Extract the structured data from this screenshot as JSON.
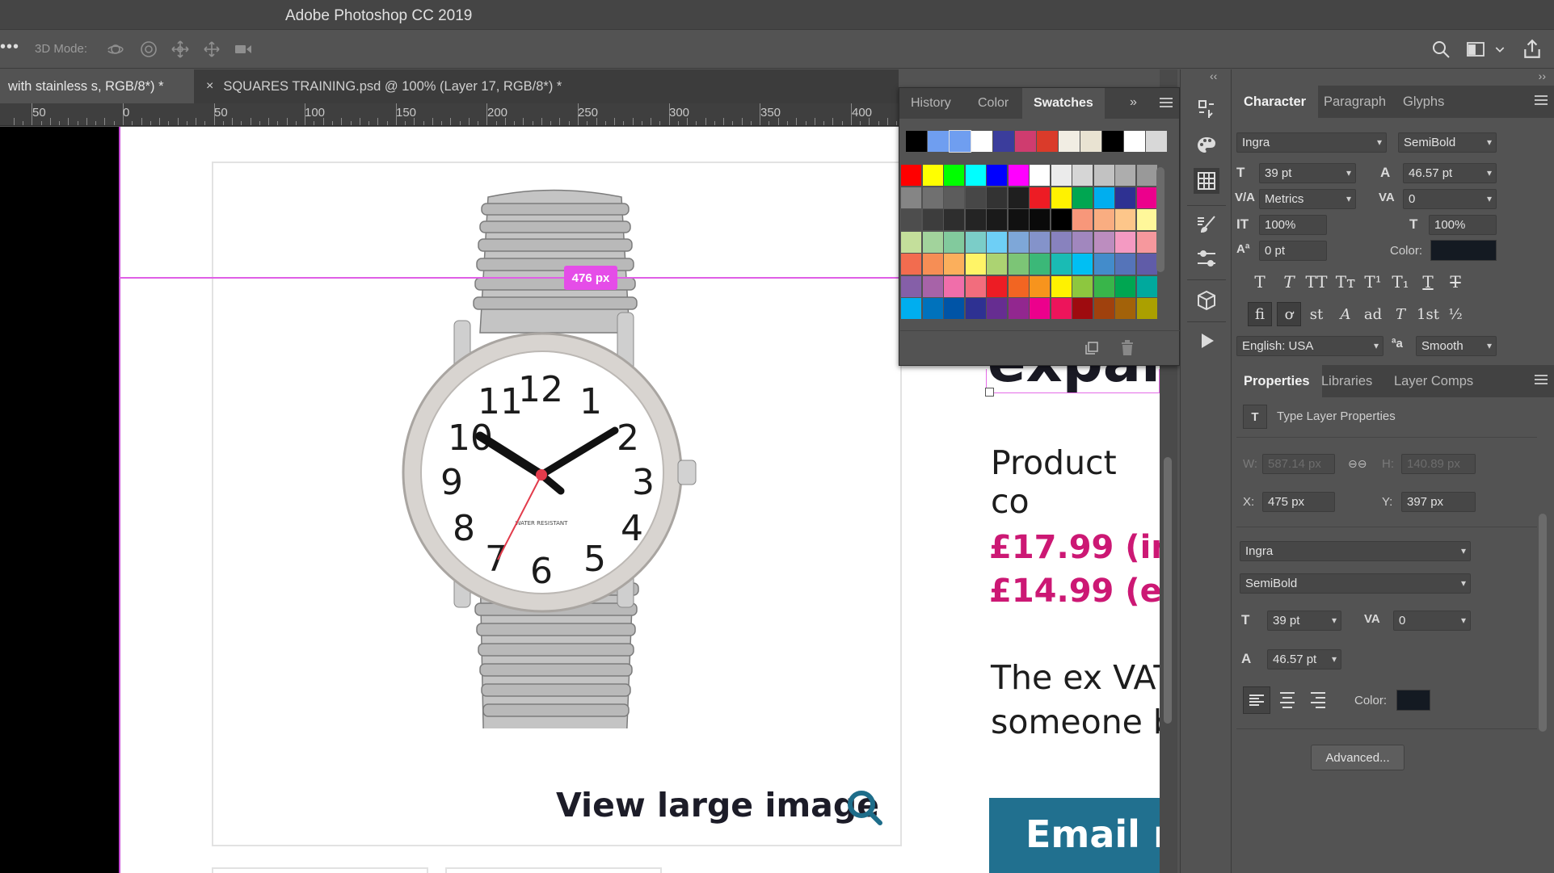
{
  "app": {
    "title": "Adobe Photoshop CC 2019"
  },
  "options_bar": {
    "more_label": "•••",
    "mode_label": "3D Mode:",
    "icons": [
      "orbit-3d-icon",
      "roll-3d-icon",
      "drag-3d-icon",
      "slide-3d-icon",
      "scale-3d-video-icon"
    ],
    "right_icons": [
      "search-icon",
      "workspace-icon",
      "chevron-down-icon",
      "share-icon"
    ]
  },
  "tabs": [
    {
      "label": "with stainless s, RGB/8*) *",
      "active": true
    },
    {
      "close": "×",
      "label": "SQUARES TRAINING.psd @ 100% (Layer 17, RGB/8*) *",
      "active": false
    }
  ],
  "ruler": {
    "labels": [
      "50",
      "0",
      "50",
      "100",
      "150",
      "200",
      "250",
      "300",
      "350",
      "400"
    ]
  },
  "canvas": {
    "measure_badge": "476 px",
    "view_large": "View large image",
    "heading_fragment": "expai",
    "product_text": "Product co",
    "price_inc": "£17.99  (in",
    "price_ex": "£14.99  (ex",
    "ex_vat_line1": "The ex VAT",
    "ex_vat_line2": "someone b",
    "email_button": "Email n",
    "watch_numbers": [
      "12",
      "1",
      "2",
      "3",
      "4",
      "5",
      "6",
      "7",
      "8",
      "9",
      "10",
      "11"
    ],
    "watch_text": "WATER RESISTANT"
  },
  "swatches_panel": {
    "tabs": [
      "History",
      "Color",
      "Swatches"
    ],
    "active_tab": "Swatches",
    "expand_icon": "»",
    "recent": [
      "#000000",
      "#6f9ef0",
      "#6f9ef0",
      "#ffffff",
      "#3b3d9c",
      "#cf3c6f",
      "#da3b2a",
      "#f1ede3",
      "#e9e3d2",
      "#000000",
      "#ffffff",
      "#d8d8d8"
    ],
    "grid": [
      "#ff0000",
      "#ffff00",
      "#00ff00",
      "#00ffff",
      "#0000ff",
      "#ff00ff",
      "#ffffff",
      "#ebebeb",
      "#d6d6d6",
      "#c2c2c2",
      "#adadad",
      "#999999",
      "#858585",
      "#707070",
      "#5c5c5c",
      "#474747",
      "#333333",
      "#1f1f1f",
      "#ed1c24",
      "#fff200",
      "#00a651",
      "#00aeef",
      "#2e3192",
      "#ec008c",
      "#4d4d4d",
      "#3d3d3d",
      "#2e2e2e",
      "#242424",
      "#1a1a1a",
      "#111111",
      "#0a0a0a",
      "#000000",
      "#f7977a",
      "#f9ad81",
      "#fdc68a",
      "#fff79a",
      "#c4df9b",
      "#a2d39c",
      "#82ca9d",
      "#7bcdc8",
      "#6ecff6",
      "#7ea7d8",
      "#8493ca",
      "#8882be",
      "#a187be",
      "#bc8dbf",
      "#f49ac2",
      "#f6989d",
      "#f26c4f",
      "#f68e55",
      "#fbaf5c",
      "#fff467",
      "#acd372",
      "#7cc576",
      "#3bb878",
      "#1abbb4",
      "#00bff3",
      "#438ccb",
      "#5574b9",
      "#605ca8",
      "#855fa8",
      "#a763a8",
      "#f06eaa",
      "#f26d7d",
      "#ed1c24",
      "#f26522",
      "#f7941d",
      "#fff200",
      "#8dc73f",
      "#39b54a",
      "#00a651",
      "#00a99d",
      "#00aeef",
      "#0072bc",
      "#0054a6",
      "#2e3192",
      "#662d91",
      "#92278f",
      "#ec008c",
      "#ed145b",
      "#9e0b0f",
      "#a0410d",
      "#a36209",
      "#aba000"
    ],
    "bottom_icons": [
      "new-swatch-icon",
      "trash-icon"
    ]
  },
  "toolstrip": {
    "collapse": "‹‹",
    "icons": [
      "history-panel-icon",
      "color-panel-icon",
      "swatches-panel-icon",
      "brush-panel-icon",
      "adjustments-panel-icon",
      "3d-panel-icon",
      "actions-play-icon"
    ]
  },
  "character_panel": {
    "collapse": "››",
    "tabs": [
      "Character",
      "Paragraph",
      "Glyphs"
    ],
    "active_tab": "Character",
    "font_family": "Ingra",
    "font_style": "SemiBold",
    "size": "39 pt",
    "leading": "46.57 pt",
    "kerning": "Metrics",
    "tracking": "0",
    "vertical_scale": "100%",
    "horizontal_scale": "100%",
    "baseline_shift": "0 pt",
    "color_label": "Color:",
    "text_color": "#141a22",
    "style_buttons": [
      "T",
      "T",
      "TT",
      "Tт",
      "T¹",
      "T₁",
      "T",
      "T"
    ],
    "opentype_buttons": [
      "fi",
      "ơ",
      "st",
      "A",
      "ad",
      "T",
      "1st",
      "½"
    ],
    "language": "English: USA",
    "aa_symbol": "ªa",
    "antialias": "Smooth"
  },
  "properties_panel": {
    "tabs": [
      "Properties",
      "Libraries",
      "Layer Comps"
    ],
    "active_tab": "Properties",
    "section_title": "Type Layer Properties",
    "w_label": "W:",
    "w_value": "587.14 px",
    "h_label": "H:",
    "h_value": "140.89 px",
    "x_label": "X:",
    "x_value": "475 px",
    "y_label": "Y:",
    "y_value": "397 px",
    "font_family": "Ingra",
    "font_style": "SemiBold",
    "size": "39 pt",
    "tracking": "0",
    "leading": "46.57 pt",
    "color_label": "Color:",
    "text_color": "#141a22",
    "advanced_label": "Advanced..."
  }
}
